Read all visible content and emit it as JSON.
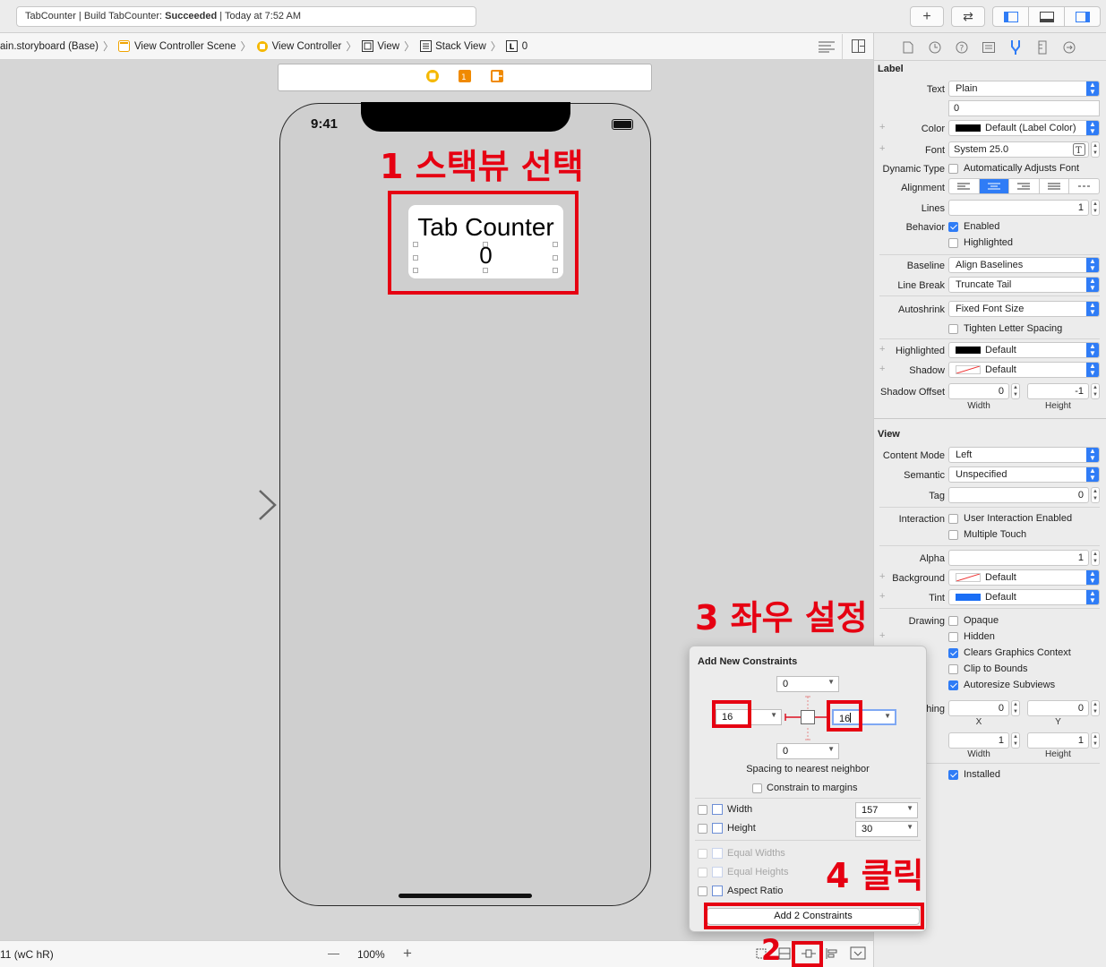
{
  "toolbar": {
    "status_prefix": "TabCounter | Build TabCounter: ",
    "status_result": "Succeeded",
    "status_suffix": " | Today at 7:52 AM",
    "add_label": "+",
    "back_forward_label": "⇄"
  },
  "jumpbar": {
    "crumbs": [
      "ain.storyboard (Base)",
      "View Controller Scene",
      "View Controller",
      "View",
      "Stack View",
      "0"
    ]
  },
  "device": {
    "time": "9:41"
  },
  "stack_view": {
    "title_label": "Tab Counter",
    "value_label": "0"
  },
  "annotations": {
    "step1": "1 스택뷰 선택",
    "step2": "2",
    "step3": "3 좌우 설정",
    "step4": "4 클릭"
  },
  "bottombar": {
    "device_config": "11 (wC hR)",
    "zoom": "100%",
    "zoom_out": "—",
    "zoom_in": "+"
  },
  "inspector": {
    "label_section": "Label",
    "text_label": "Text",
    "text_value": "Plain",
    "text_content": "0",
    "color_label": "Color",
    "color_value": "Default (Label Color)",
    "font_label": "Font",
    "font_value": "System 25.0",
    "dynamic_type_label": "Dynamic Type",
    "dynamic_type_value": "Automatically Adjusts Font",
    "alignment_label": "Alignment",
    "lines_label": "Lines",
    "lines_value": "1",
    "behavior_label": "Behavior",
    "enabled_label": "Enabled",
    "highlighted_cb_label": "Highlighted",
    "baseline_label": "Baseline",
    "baseline_value": "Align Baselines",
    "linebreak_label": "Line Break",
    "linebreak_value": "Truncate Tail",
    "autoshrink_label": "Autoshrink",
    "autoshrink_value": "Fixed Font Size",
    "tighten_label": "Tighten Letter Spacing",
    "highlighted_label": "Highlighted",
    "highlighted_value": "Default",
    "shadow_label": "Shadow",
    "shadow_value": "Default",
    "shadow_offset_label": "Shadow Offset",
    "shadow_offset_w": "0",
    "shadow_offset_h": "-1",
    "width_sub": "Width",
    "height_sub": "Height",
    "view_section": "View",
    "content_mode_label": "Content Mode",
    "content_mode_value": "Left",
    "semantic_label": "Semantic",
    "semantic_value": "Unspecified",
    "tag_label": "Tag",
    "tag_value": "0",
    "interaction_label": "Interaction",
    "user_interaction_label": "User Interaction Enabled",
    "multiple_touch_label": "Multiple Touch",
    "alpha_label": "Alpha",
    "alpha_value": "1",
    "background_label": "Background",
    "background_value": "Default",
    "tint_label": "Tint",
    "tint_value": "Default",
    "drawing_label": "Drawing",
    "opaque_label": "Opaque",
    "hidden_label": "Hidden",
    "clears_label": "Clears Graphics Context",
    "clip_label": "Clip to Bounds",
    "autoresize_label": "Autoresize Subviews",
    "stretching_label": "hing",
    "stretch_x": "0",
    "stretch_y": "0",
    "x_sub": "X",
    "y_sub": "Y",
    "stretch_w": "1",
    "stretch_h": "1",
    "installed_label": "Installed"
  },
  "constraints_popup": {
    "title": "Add New Constraints",
    "top_value": "0",
    "left_value": "16",
    "right_value": "16",
    "bottom_value": "0",
    "spacing_caption": "Spacing to nearest neighbor",
    "constrain_margins_label": "Constrain to margins",
    "width_label": "Width",
    "width_value": "157",
    "height_label": "Height",
    "height_value": "30",
    "equal_widths_label": "Equal Widths",
    "equal_heights_label": "Equal Heights",
    "aspect_ratio_label": "Aspect Ratio",
    "add_button_label": "Add 2 Constraints"
  },
  "colors": {
    "accent_blue": "#2f7cf6",
    "annotation_red": "#e60012",
    "tint_blue": "#1a6ef5"
  }
}
